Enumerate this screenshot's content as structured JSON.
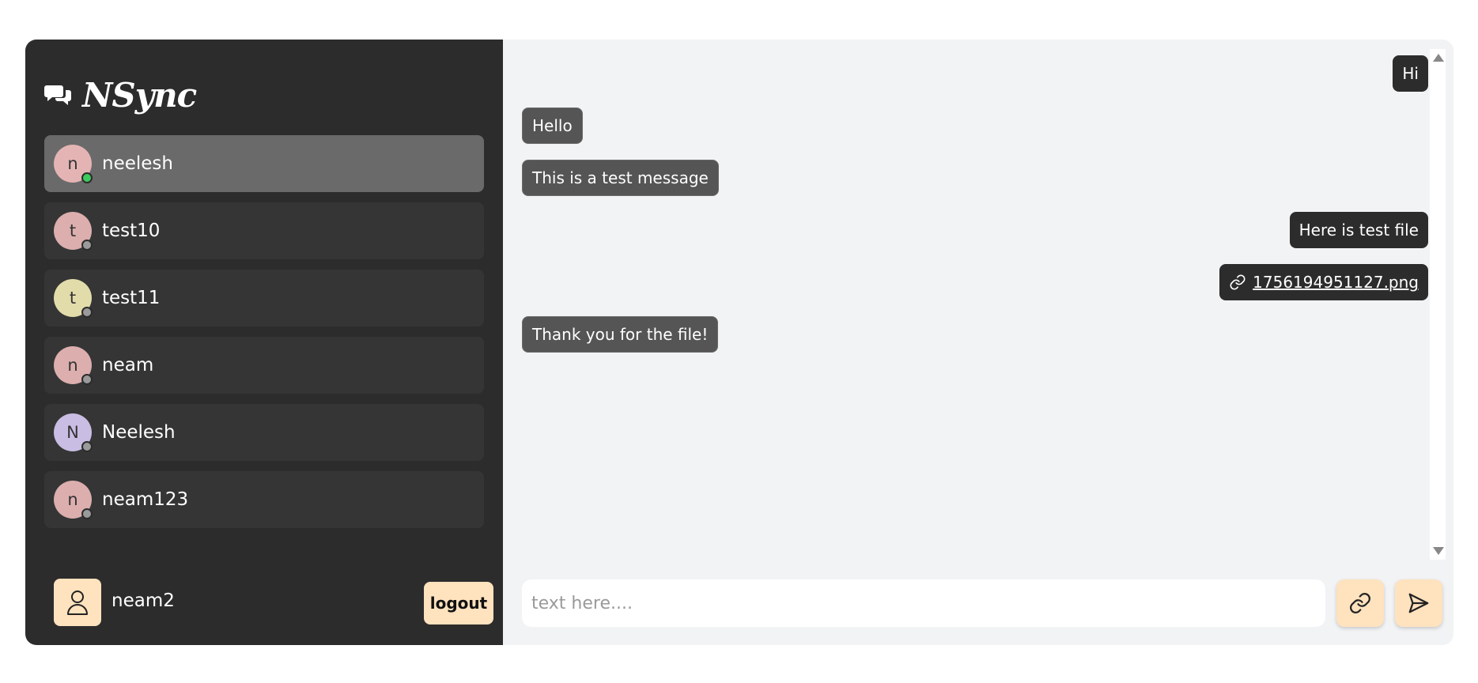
{
  "brand": {
    "name": "NSync"
  },
  "contacts": [
    {
      "name": "neelesh",
      "initial": "n",
      "avatar_color": "#e4b4b4",
      "status": "online",
      "active": true
    },
    {
      "name": "test10",
      "initial": "t",
      "avatar_color": "#dcaeae",
      "status": "offline",
      "active": false
    },
    {
      "name": "test11",
      "initial": "t",
      "avatar_color": "#e2dcaa",
      "status": "offline",
      "active": false
    },
    {
      "name": "neam",
      "initial": "n",
      "avatar_color": "#dcaeae",
      "status": "offline",
      "active": false
    },
    {
      "name": "Neelesh",
      "initial": "N",
      "avatar_color": "#c9bde3",
      "status": "offline",
      "active": false
    },
    {
      "name": "neam123",
      "initial": "n",
      "avatar_color": "#dcaeae",
      "status": "offline",
      "active": false
    }
  ],
  "status_colors": {
    "online": "#3ccb5e",
    "offline": "#9a9a9a"
  },
  "current_user": {
    "name": "neam2"
  },
  "logout_label": "logout",
  "messages": [
    {
      "text": "Hi",
      "direction": "out",
      "type": "text"
    },
    {
      "text": "Hello",
      "direction": "in",
      "type": "text"
    },
    {
      "text": "This is a test message",
      "direction": "in",
      "type": "text"
    },
    {
      "text": "Here is test file",
      "direction": "out",
      "type": "text"
    },
    {
      "text": "1756194951127.png",
      "direction": "out",
      "type": "file"
    },
    {
      "text": "Thank you for the file!",
      "direction": "in",
      "type": "text"
    }
  ],
  "composer": {
    "placeholder": "text here...."
  },
  "colors": {
    "sidebar": "#2c2c2c",
    "accent": "#ffe2be",
    "chat_bg": "#f2f3f5"
  }
}
